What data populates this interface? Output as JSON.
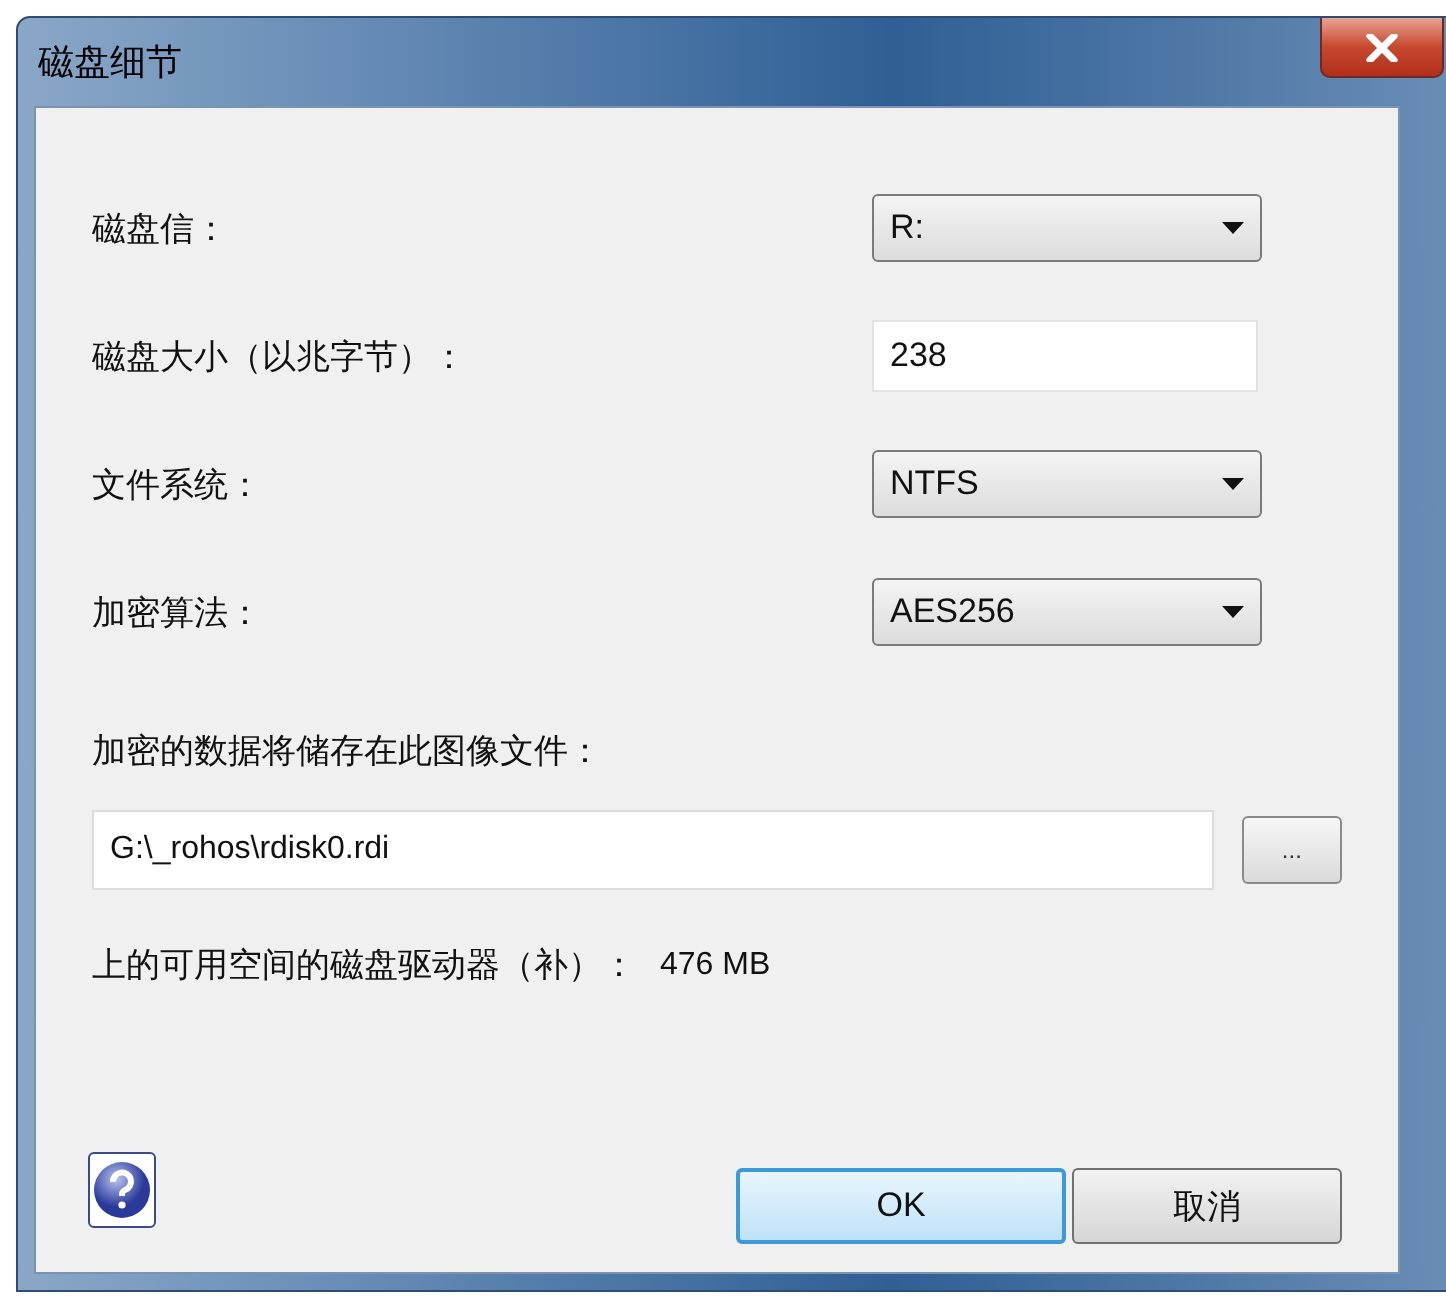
{
  "window": {
    "title": "磁盘细节"
  },
  "fields": [
    {
      "kind": "dropdown",
      "label": "磁盘信：",
      "value": "R:"
    },
    {
      "kind": "text",
      "label": "磁盘大小（以兆字节）：",
      "value": "238"
    },
    {
      "kind": "dropdown",
      "label": "文件系统：",
      "value": "NTFS"
    },
    {
      "kind": "dropdown",
      "label": "加密算法：",
      "value": "AES256"
    }
  ],
  "image_file": {
    "label": "加密的数据将储存在此图像文件：",
    "value": "G:\\_rohos\\rdisk0.rdi",
    "browse": "..."
  },
  "free_space": {
    "label": "上的可用空间的磁盘驱动器（补）：",
    "value": "476 MB"
  },
  "buttons": [
    {
      "label": "OK",
      "default": true
    },
    {
      "label": "取消",
      "default": false
    }
  ]
}
